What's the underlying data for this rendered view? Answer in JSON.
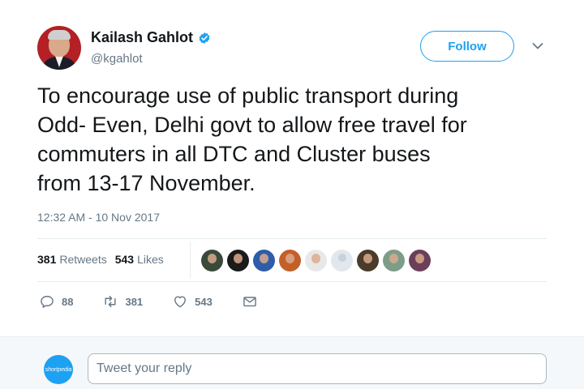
{
  "author": {
    "name": "Kailash Gahlot",
    "handle": "@kgahlot",
    "verified": true
  },
  "follow_label": "Follow",
  "tweet_text": "To encourage use of public transport during\nOdd- Even, Delhi govt to allow free travel for\ncommuters in all DTC and Cluster buses\nfrom 13-17 November.",
  "timestamp": "12:32 AM - 10 Nov 2017",
  "stats": {
    "retweets_count": "381",
    "retweets_label": "Retweets",
    "likes_count": "543",
    "likes_label": "Likes"
  },
  "likers": [
    {
      "color": "#3a4a3a"
    },
    {
      "color": "#1b1b1b"
    },
    {
      "color": "#2f5da8"
    },
    {
      "color": "#c3602a"
    },
    {
      "color": "#e8e8e8"
    },
    {
      "color": "#e1e8ed"
    },
    {
      "color": "#4a3b2b"
    },
    {
      "color": "#7d9d8a"
    },
    {
      "color": "#6b3f5a"
    }
  ],
  "actions": {
    "reply_count": "88",
    "retweet_count": "381",
    "like_count": "543"
  },
  "reply_box": {
    "placeholder": "Tweet your reply",
    "avatar_label": "shortpedia"
  },
  "colors": {
    "accent": "#1da1f2",
    "text_primary": "#14171a",
    "text_secondary": "#657786"
  }
}
